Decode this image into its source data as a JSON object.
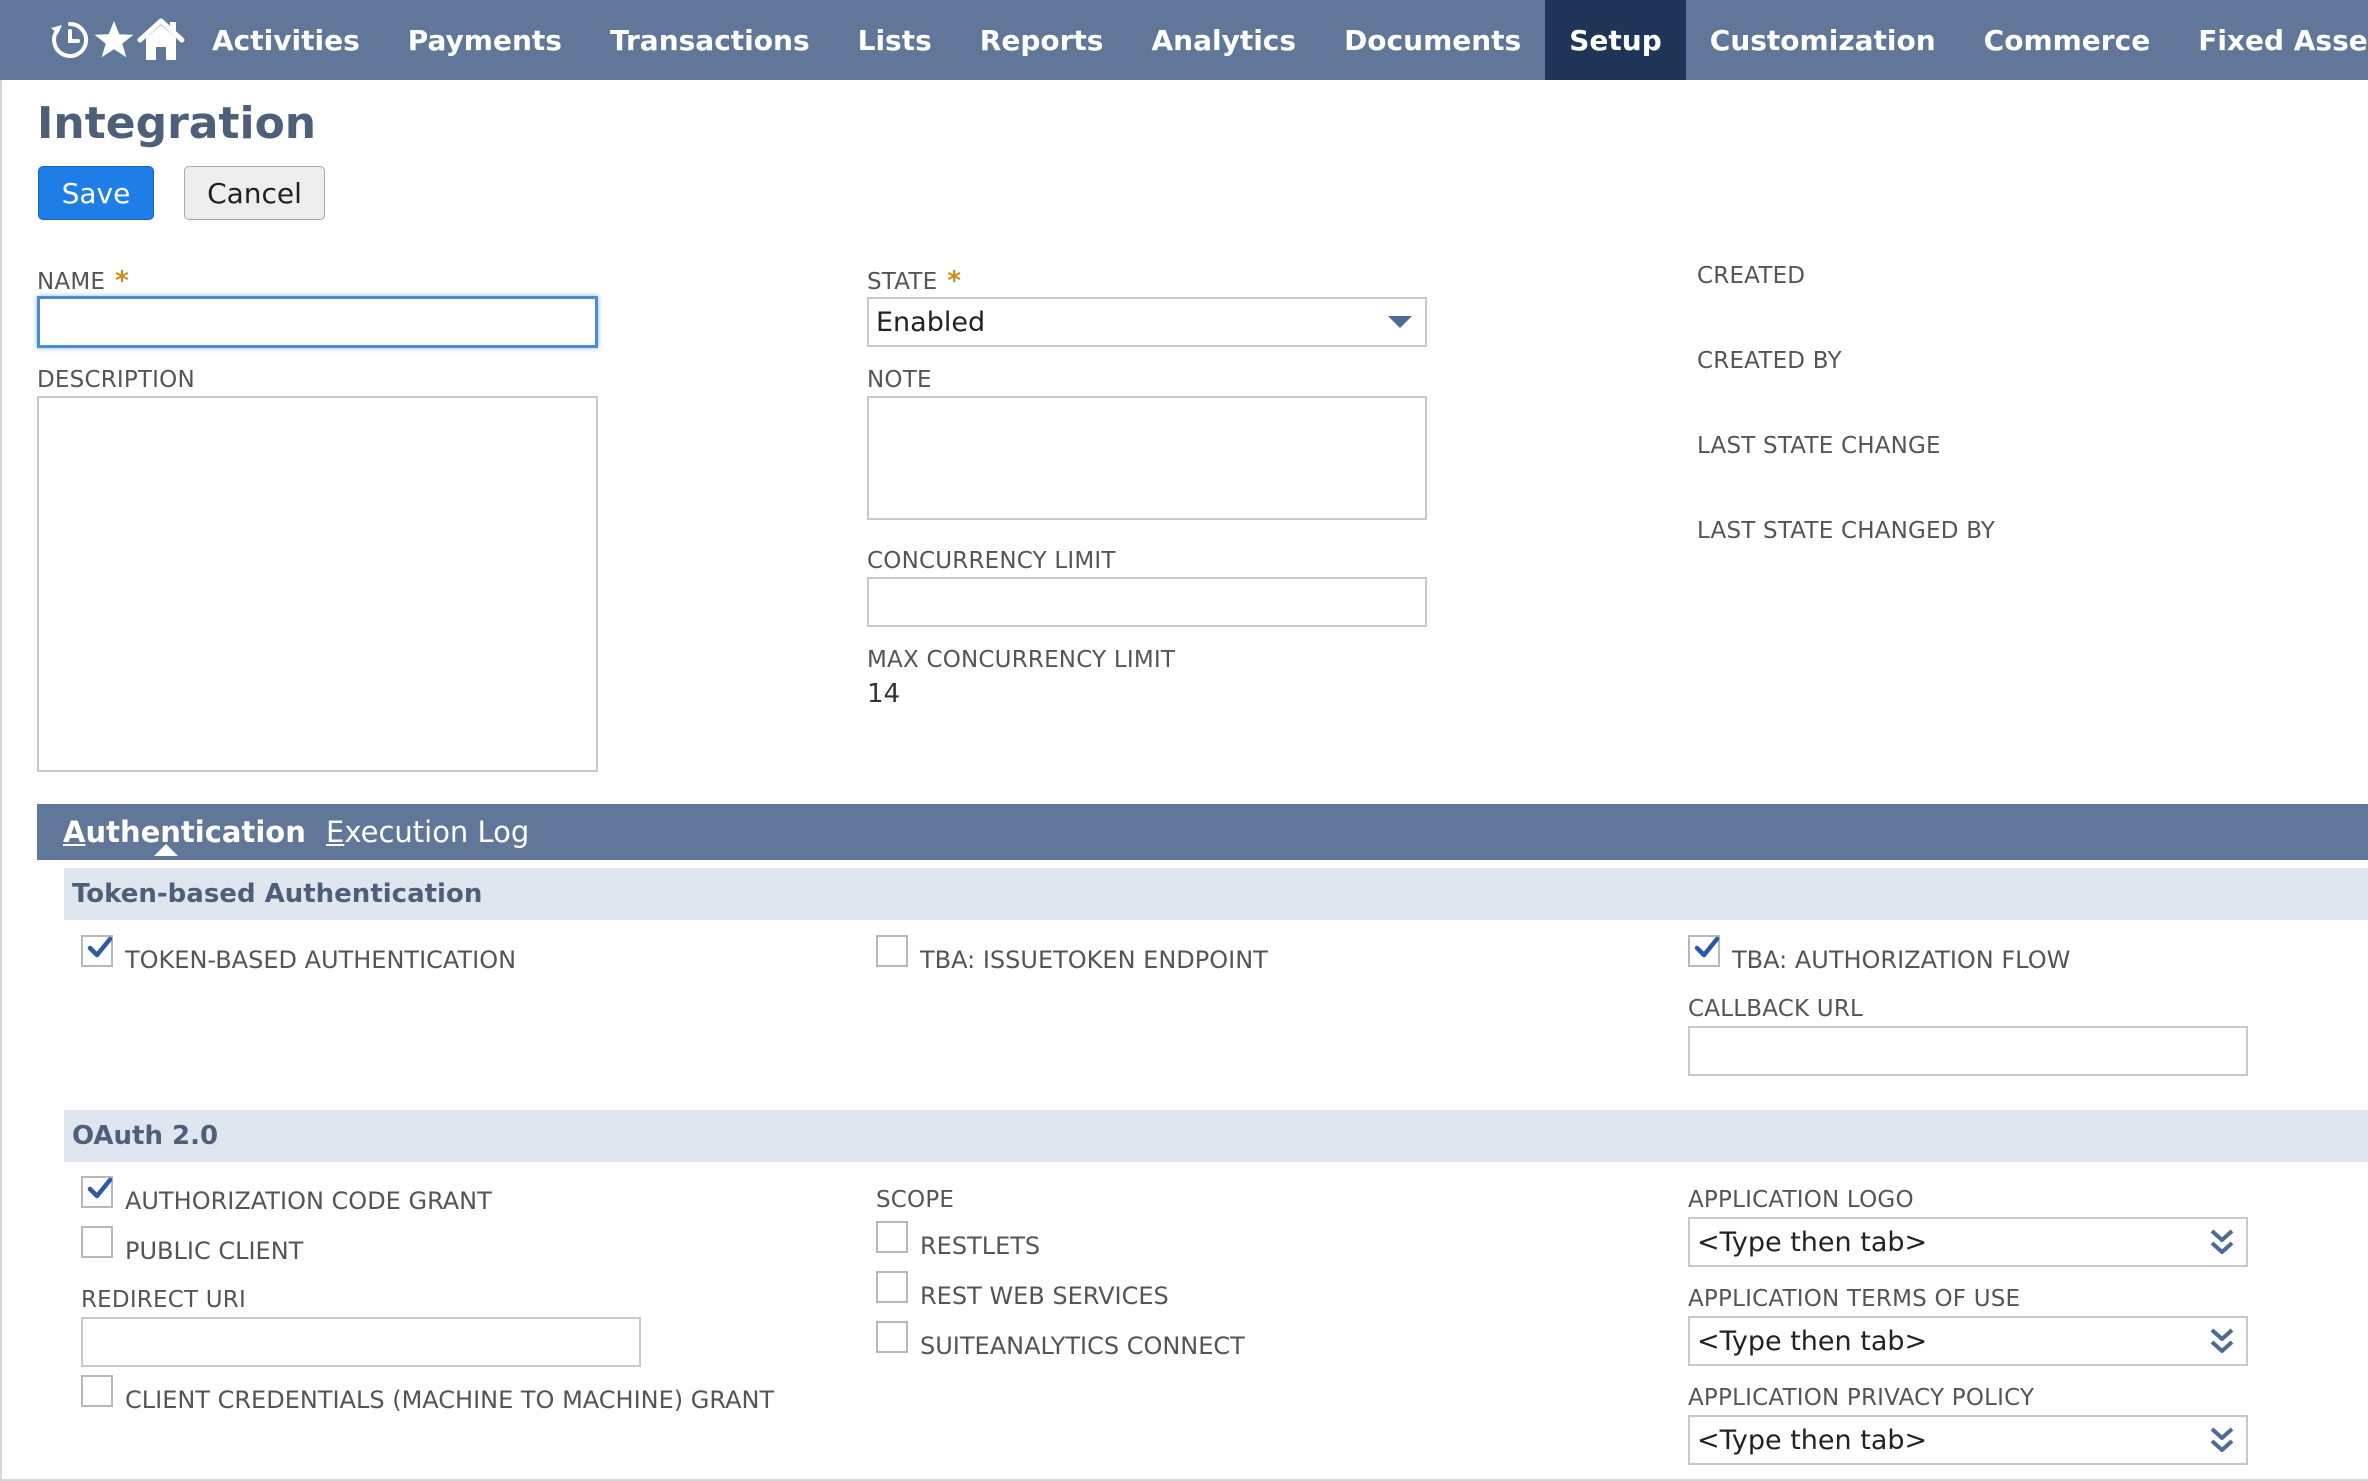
{
  "nav": {
    "icons": [
      "recent-icon",
      "star-icon",
      "home-icon"
    ],
    "items": [
      {
        "label": "Activities"
      },
      {
        "label": "Payments"
      },
      {
        "label": "Transactions"
      },
      {
        "label": "Lists"
      },
      {
        "label": "Reports"
      },
      {
        "label": "Analytics"
      },
      {
        "label": "Documents"
      },
      {
        "label": "Setup",
        "active": true
      },
      {
        "label": "Customization"
      },
      {
        "label": "Commerce"
      },
      {
        "label": "Fixed Assets"
      }
    ]
  },
  "page": {
    "title": "Integration",
    "save_label": "Save",
    "cancel_label": "Cancel"
  },
  "form": {
    "name_label": "NAME",
    "name_value": "",
    "required_mark": "*",
    "description_label": "DESCRIPTION",
    "description_value": "",
    "state_label": "STATE",
    "state_value": "Enabled",
    "note_label": "NOTE",
    "note_value": "",
    "concurrency_limit_label": "CONCURRENCY LIMIT",
    "concurrency_limit_value": "",
    "max_concurrency_limit_label": "MAX CONCURRENCY LIMIT",
    "max_concurrency_limit_value": "14",
    "created_label": "CREATED",
    "created_by_label": "CREATED BY",
    "last_state_change_label": "LAST STATE CHANGE",
    "last_state_changed_by_label": "LAST STATE CHANGED BY"
  },
  "tabs": {
    "authentication": {
      "first": "A",
      "rest": "uthentication"
    },
    "execution_log": {
      "first": "E",
      "rest": "xecution Log"
    }
  },
  "tba": {
    "header": "Token-based Authentication",
    "token_based_auth": {
      "label": "TOKEN-BASED AUTHENTICATION",
      "checked": true
    },
    "issuetoken_endpoint": {
      "label": "TBA: ISSUETOKEN ENDPOINT",
      "checked": false
    },
    "authorization_flow": {
      "label": "TBA: AUTHORIZATION FLOW",
      "checked": true
    },
    "callback_url_label": "CALLBACK URL",
    "callback_url_value": ""
  },
  "oauth": {
    "header": "OAuth 2.0",
    "auth_code_grant": {
      "label": "AUTHORIZATION CODE GRANT",
      "checked": true
    },
    "public_client": {
      "label": "PUBLIC CLIENT",
      "checked": false
    },
    "redirect_uri_label": "REDIRECT URI",
    "redirect_uri_value": "",
    "client_credentials": {
      "label": "CLIENT CREDENTIALS (MACHINE TO MACHINE) GRANT",
      "checked": false
    },
    "scope_label": "SCOPE",
    "restlets": {
      "label": "RESTLETS",
      "checked": false
    },
    "rest_web_services": {
      "label": "REST WEB SERVICES",
      "checked": false
    },
    "suiteanalytics_connect": {
      "label": "SUITEANALYTICS CONNECT",
      "checked": false
    },
    "app_logo_label": "APPLICATION LOGO",
    "app_logo_value": "<Type then tab>",
    "app_terms_label": "APPLICATION TERMS OF USE",
    "app_terms_value": "<Type then tab>",
    "app_privacy_label": "APPLICATION PRIVACY POLICY",
    "app_privacy_value": "<Type then tab>"
  },
  "colors": {
    "nav_bg": "#607799",
    "nav_active": "#1f3557",
    "save_btn": "#1f7de7",
    "section_bg": "#e0e6ef",
    "required": "#d68a14"
  }
}
